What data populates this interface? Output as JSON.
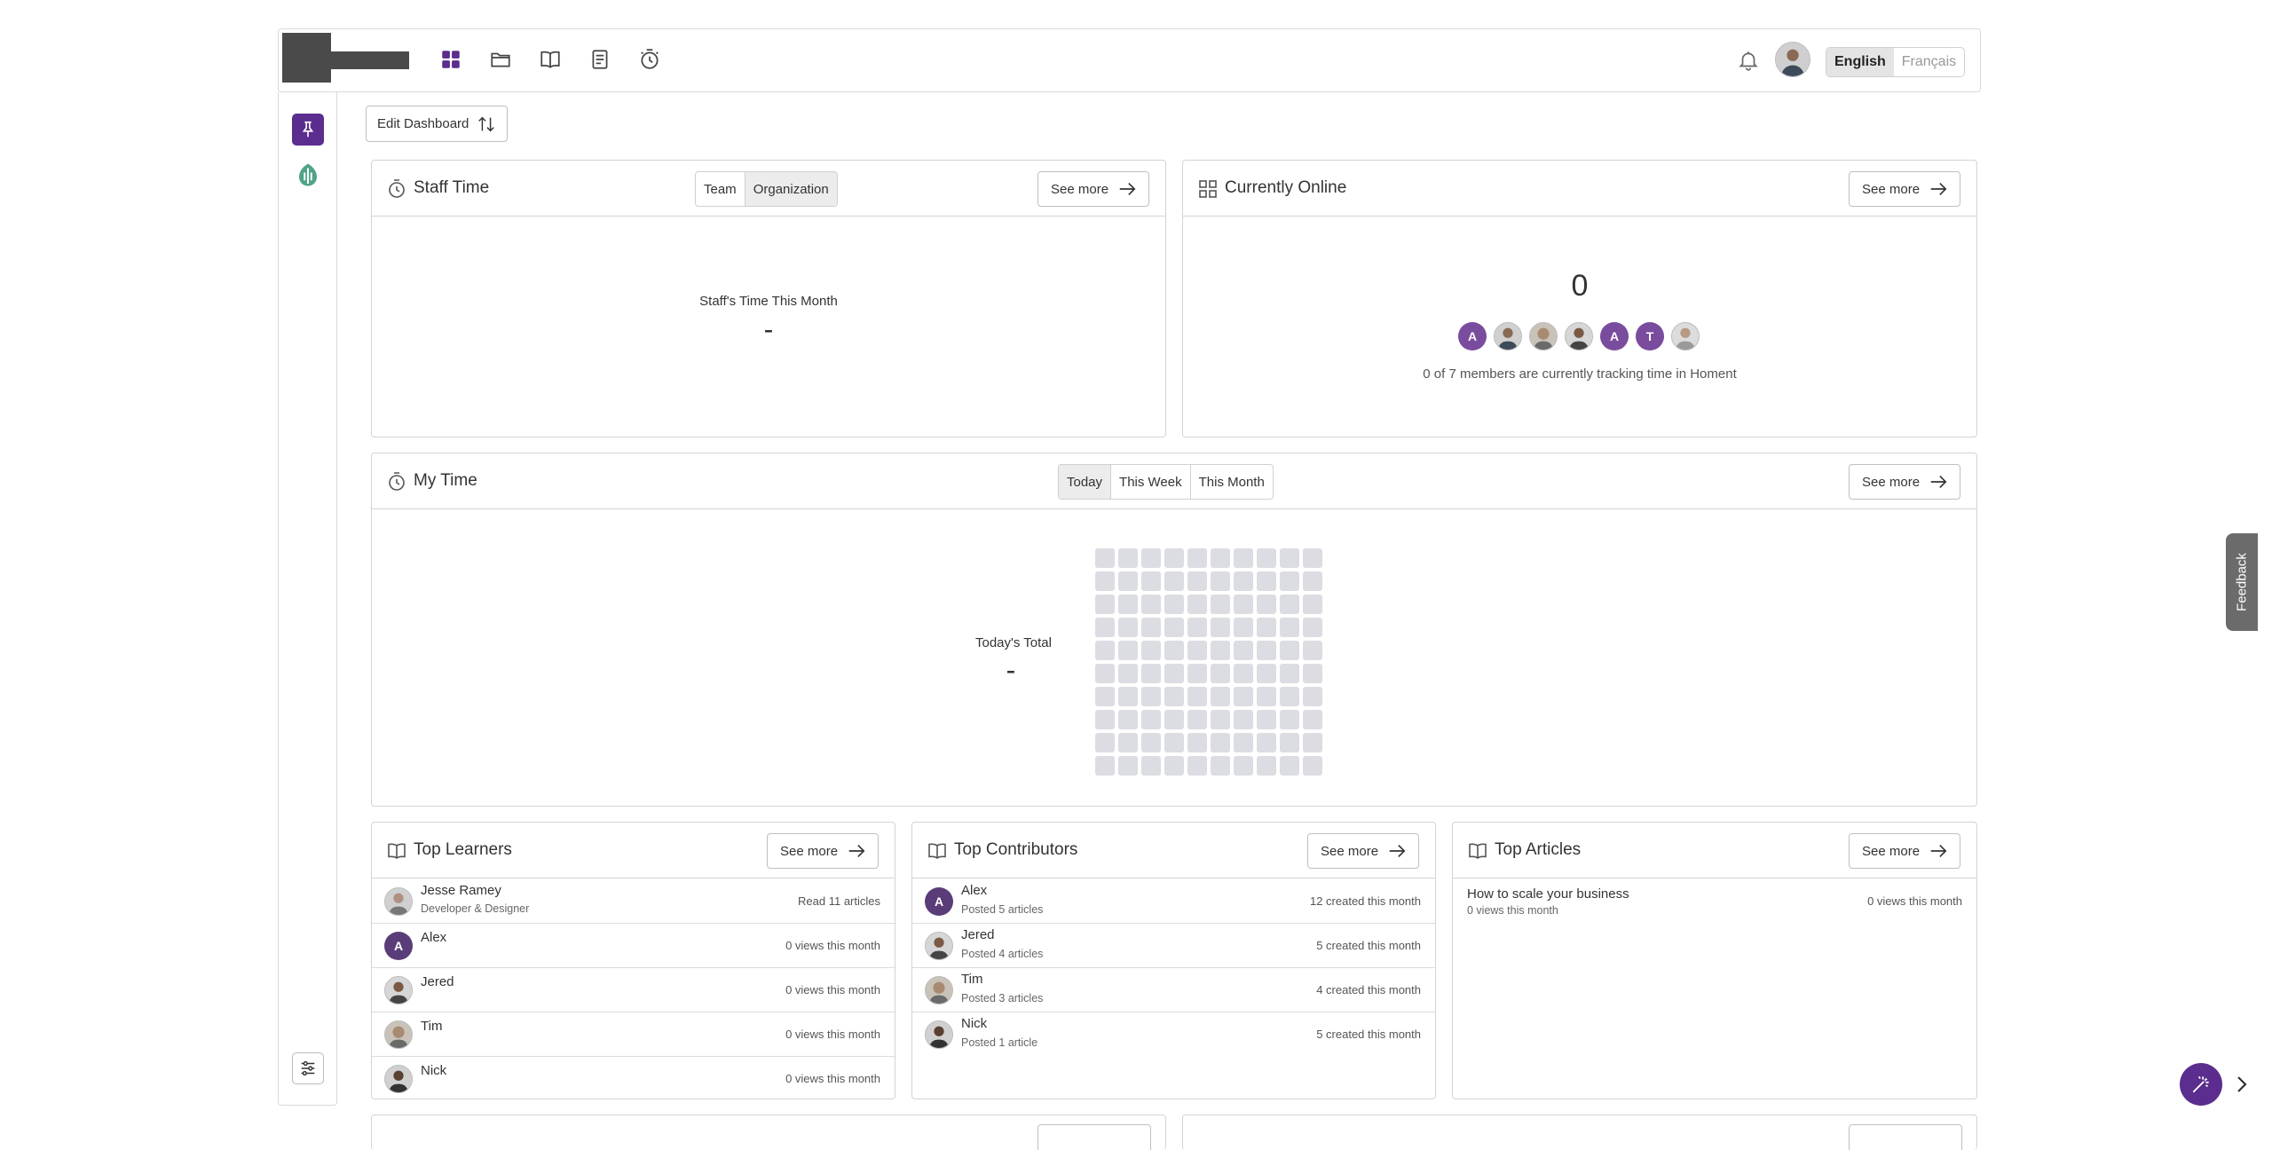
{
  "header": {
    "languages": [
      "English",
      "Français"
    ],
    "nav_icons": [
      "dashboard-icon",
      "folder-icon",
      "book-icon",
      "document-icon",
      "stopwatch-icon"
    ]
  },
  "toolbar": {
    "edit_dashboard": "Edit Dashboard"
  },
  "see_more": "See more",
  "staff_time": {
    "title": "Staff Time",
    "tabs": [
      "Team",
      "Organization"
    ],
    "caption": "Staff's Time This Month",
    "value": "-"
  },
  "online": {
    "title": "Currently Online",
    "count": "0",
    "avatars": [
      "A",
      "",
      "",
      "",
      "A",
      "T",
      ""
    ],
    "caption": "0 of 7 members are currently tracking time in Homent"
  },
  "my_time": {
    "title": "My Time",
    "tabs": [
      "Today",
      "This Week",
      "This Month"
    ],
    "caption": "Today's Total",
    "value": "-"
  },
  "learners": {
    "title": "Top Learners",
    "rows": [
      {
        "name": "Jesse Ramey",
        "sub": "Developer & Designer",
        "right": "Read 11 articles",
        "initial": ""
      },
      {
        "name": "Alex",
        "sub": "",
        "right": "0 views this month",
        "initial": "A"
      },
      {
        "name": "Jered",
        "sub": "",
        "right": "0 views this month",
        "initial": ""
      },
      {
        "name": "Tim",
        "sub": "",
        "right": "0 views this month",
        "initial": ""
      },
      {
        "name": "Nick",
        "sub": "",
        "right": "0 views this month",
        "initial": ""
      }
    ]
  },
  "contributors": {
    "title": "Top Contributors",
    "rows": [
      {
        "name": "Alex",
        "sub": "Posted 5 articles",
        "right": "12 created this month",
        "initial": "A"
      },
      {
        "name": "Jered",
        "sub": "Posted 4 articles",
        "right": "5 created this month",
        "initial": ""
      },
      {
        "name": "Tim",
        "sub": "Posted 3 articles",
        "right": "4 created this month",
        "initial": ""
      },
      {
        "name": "Nick",
        "sub": "Posted 1 article",
        "right": "5 created this month",
        "initial": ""
      }
    ]
  },
  "articles": {
    "title": "Top Articles",
    "rows": [
      {
        "name": "How to scale your business",
        "sub": "0 views this month",
        "right": "0 views this month"
      }
    ]
  },
  "feedback": "Feedback",
  "colors": {
    "accent": "#5b2d8e",
    "border": "#d4d4d4",
    "grid": "#dcdde2"
  }
}
